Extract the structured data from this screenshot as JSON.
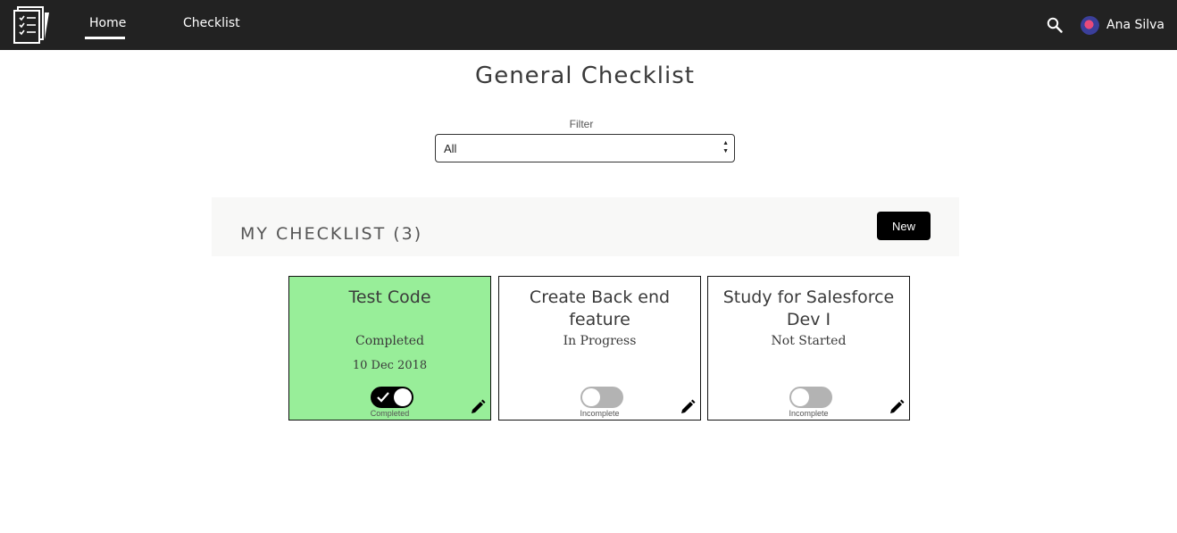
{
  "nav": {
    "tabs": [
      {
        "label": "Home",
        "active": true
      },
      {
        "label": "Checklist",
        "active": false
      }
    ],
    "icons": {
      "logo": "checklist-document-icon",
      "search": "search-icon"
    },
    "user": {
      "name": "Ana Silva"
    }
  },
  "page": {
    "title": "General Checklist"
  },
  "filter": {
    "label": "Filter",
    "value": "All"
  },
  "section": {
    "title": "MY CHECKLIST (3)",
    "new_label": "New"
  },
  "colors": {
    "topbar": "#222222",
    "completed_card": "#98ee99",
    "toggle_on": "#000000",
    "toggle_off": "#b3b3b3"
  },
  "cards": [
    {
      "title": "Test Code",
      "status": "Completed",
      "date": "10 Dec 2018",
      "toggle_label": "Completed",
      "toggle_on": true
    },
    {
      "title": "Create Back end feature",
      "status": "In Progress",
      "date": "",
      "toggle_label": "Incomplete",
      "toggle_on": false
    },
    {
      "title": "Study for Salesforce Dev I",
      "status": "Not Started",
      "date": "",
      "toggle_label": "Incomplete",
      "toggle_on": false
    }
  ]
}
